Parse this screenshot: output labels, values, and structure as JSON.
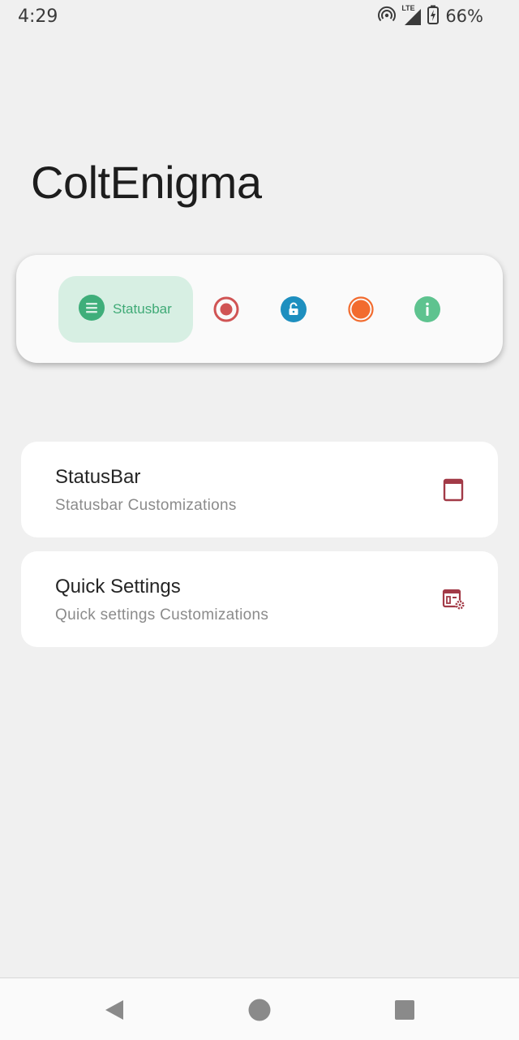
{
  "status_bar": {
    "time": "4:29",
    "network_label": "LTE",
    "battery_percent": "66%",
    "icons": [
      "hotspot-icon",
      "signal-icon",
      "battery-charging-icon"
    ]
  },
  "app": {
    "title": "ColtEnigma"
  },
  "bottom_nav": {
    "items": [
      {
        "label": "Statusbar",
        "icon": "menu-icon",
        "color": "#3fae7a",
        "selected": true
      },
      {
        "label": "",
        "icon": "record-icon",
        "color": "#d05454",
        "selected": false
      },
      {
        "label": "",
        "icon": "unlock-icon",
        "color": "#1e8fbf",
        "selected": false
      },
      {
        "label": "",
        "icon": "circle-icon",
        "color": "#f26b2e",
        "selected": false
      },
      {
        "label": "",
        "icon": "info-icon",
        "color": "#5ec38f",
        "selected": false
      }
    ]
  },
  "settings": [
    {
      "title": "StatusBar",
      "subtitle": "Statusbar Customizations",
      "icon": "window-icon"
    },
    {
      "title": "Quick Settings",
      "subtitle": "Quick settings Customizations",
      "icon": "panel-settings-icon"
    }
  ],
  "colors": {
    "background": "#f0f0f0",
    "accent_green": "#3fae7a",
    "pill_bg": "#d7efe3",
    "icon_dark_red": "#a23a47"
  },
  "system_nav": [
    "back-button",
    "home-button",
    "recents-button"
  ]
}
